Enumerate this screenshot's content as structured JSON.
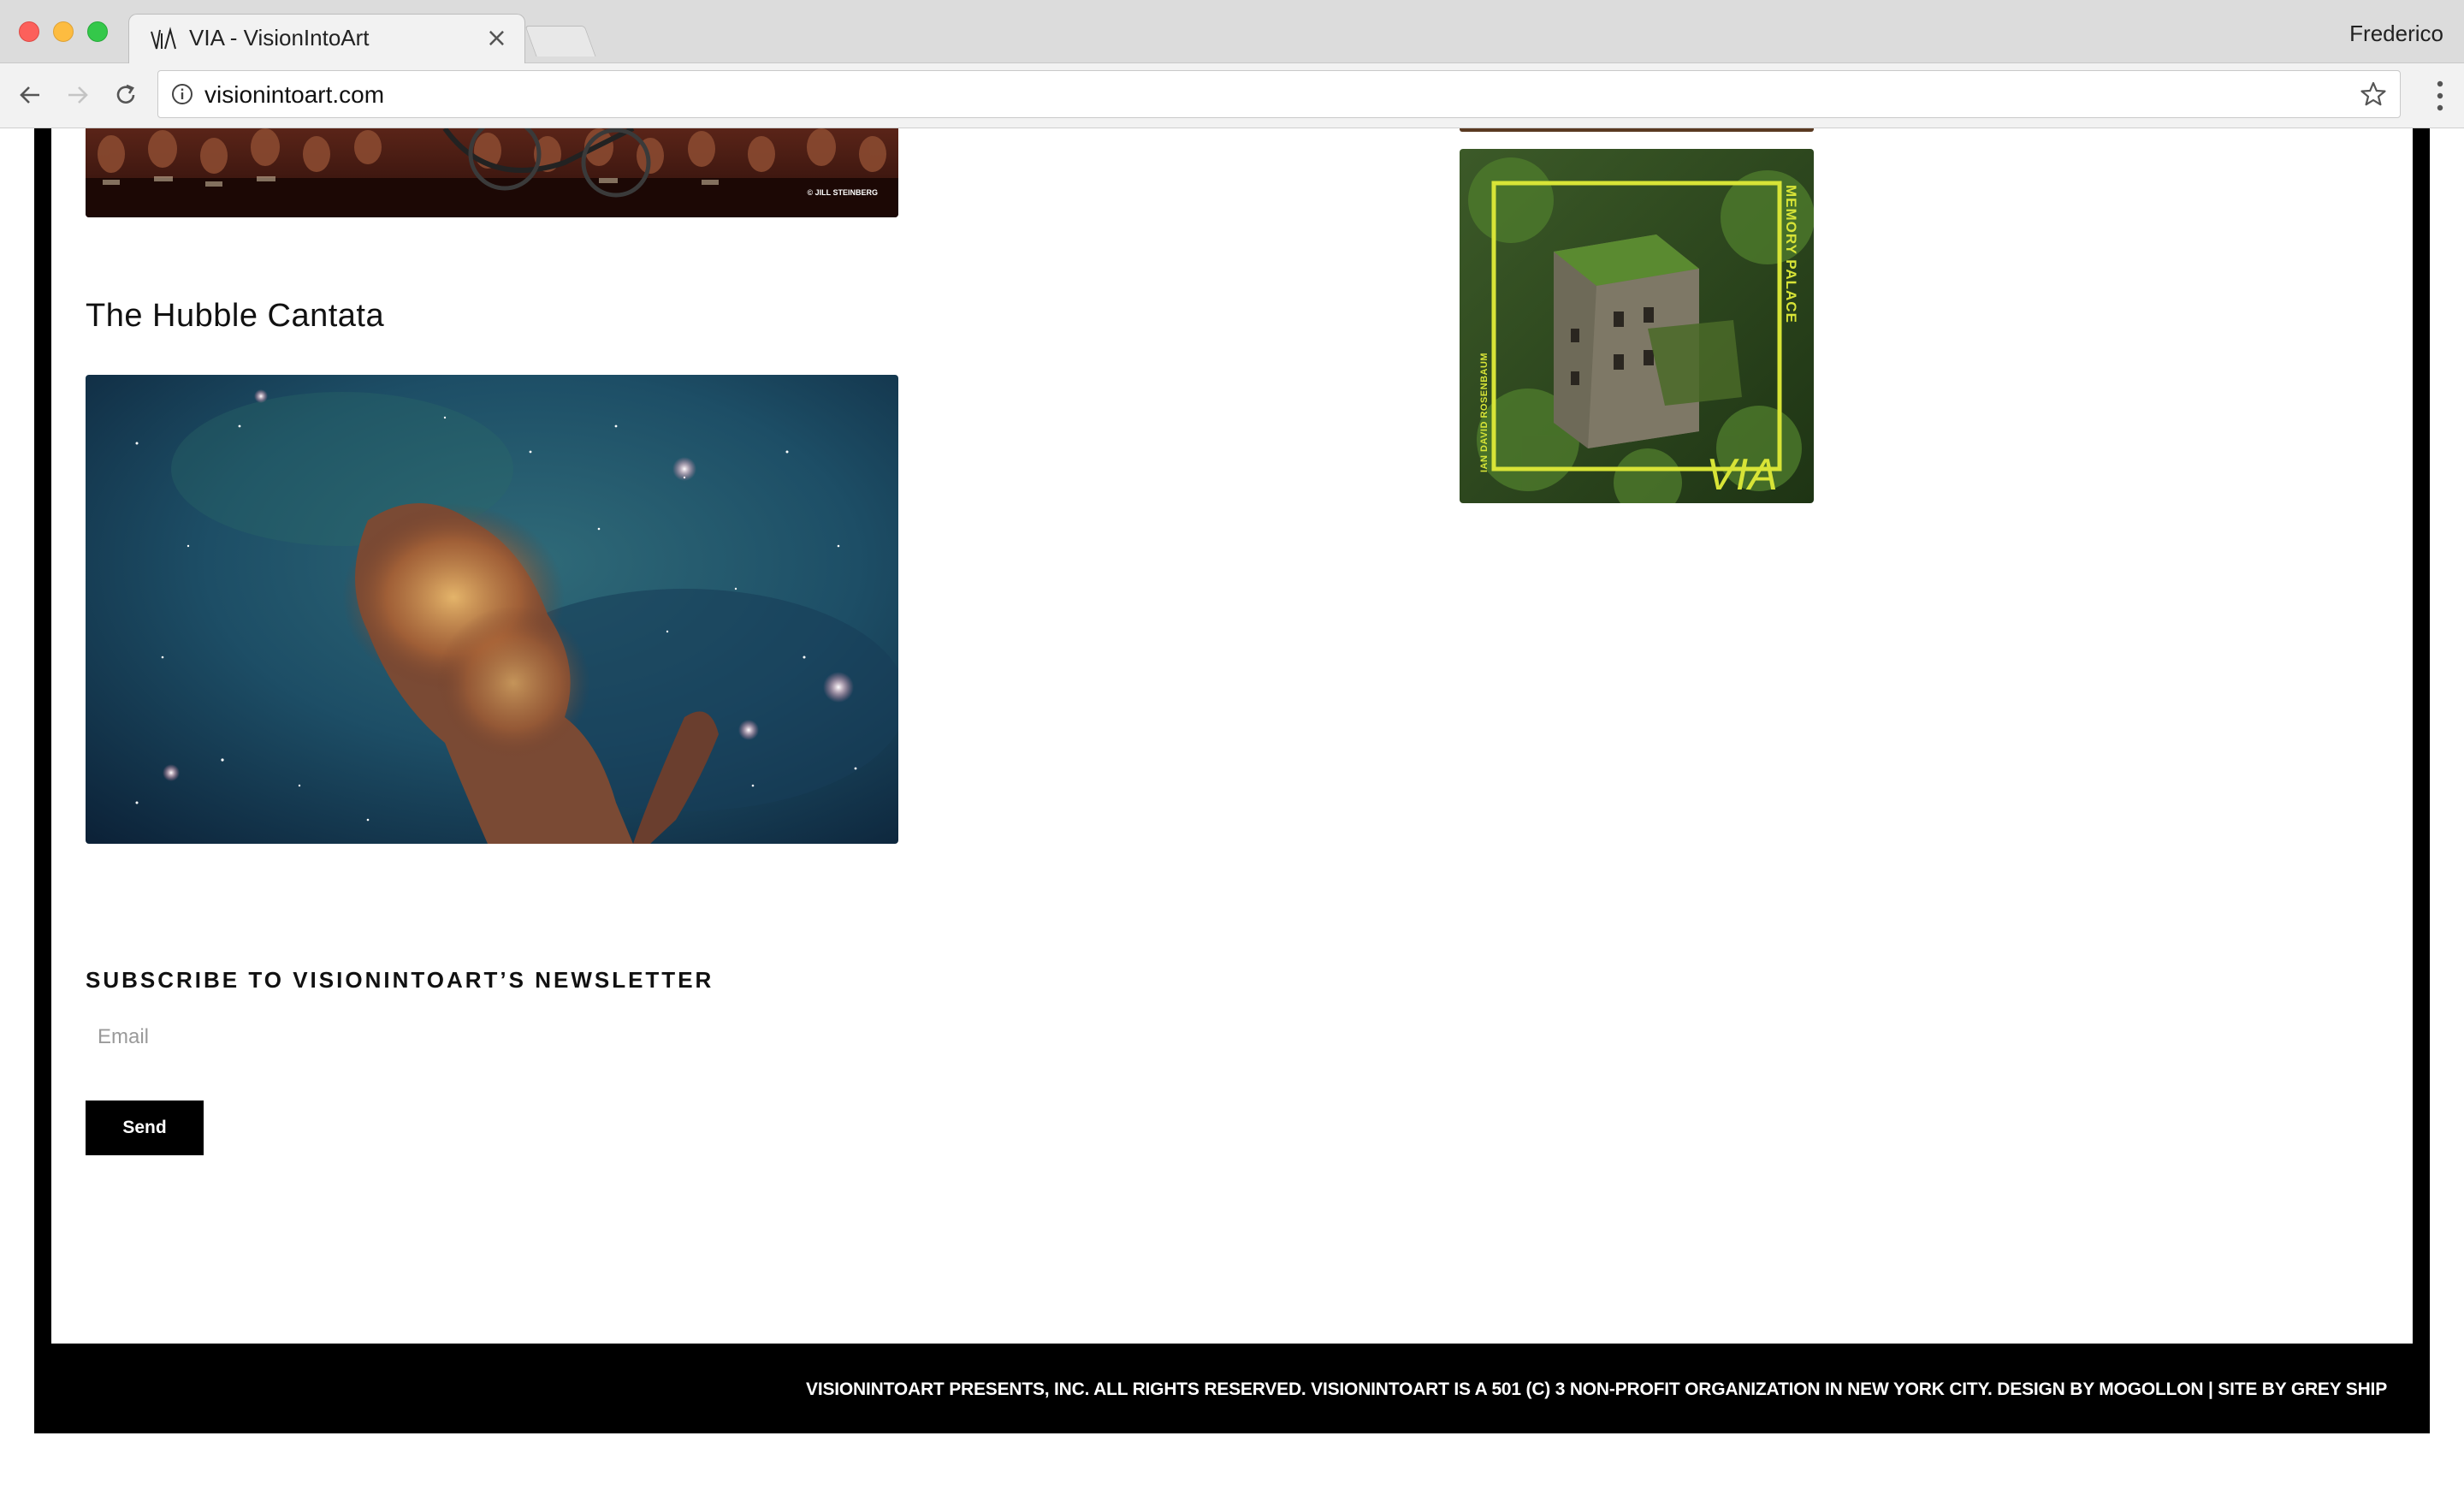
{
  "browser": {
    "tab_title": "VIA - VisionIntoArt",
    "tab_close": "×",
    "profile_name": "Frederico",
    "url": "visionintoart.com"
  },
  "page": {
    "photo_credit": "© JILL STEINBERG",
    "hubble_heading": "The Hubble Cantata",
    "album_cover": {
      "title_text": "MEMORY PALACE",
      "artist_text": "IAN DAVID ROSENBAUM",
      "logo_text": "VIA"
    },
    "newsletter": {
      "title": "SUBSCRIBE TO VISIONINTOART’S NEWSLETTER",
      "email_placeholder": "Email",
      "send_label": "Send"
    },
    "footer": {
      "text": "VISIONINTOART PRESENTS, INC. ALL RIGHTS RESERVED. VISIONINTOART IS A 501 (C) 3 NON-PROFIT ORGANIZATION IN NEW YORK CITY. DESIGN BY MOGOLLON | SITE BY GREY SHIP"
    }
  },
  "colors": {
    "frame": "#000000",
    "accent_yellow": "#d8e437",
    "button_bg": "#000000",
    "button_text": "#ffffff"
  }
}
